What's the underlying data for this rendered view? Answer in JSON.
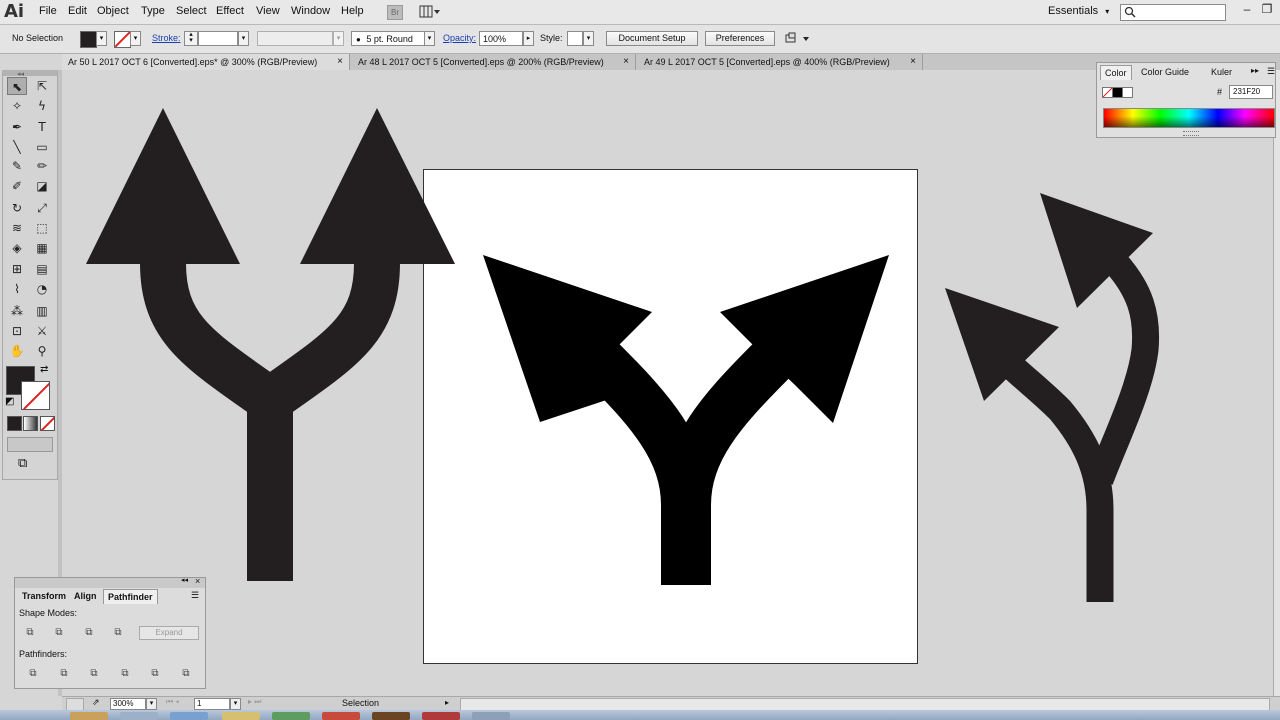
{
  "app": {
    "logo": "Ai"
  },
  "menu": [
    "File",
    "Edit",
    "Object",
    "Type",
    "Select",
    "Effect",
    "View",
    "Window",
    "Help"
  ],
  "bridge_icon": "Br",
  "workspace": {
    "label": "Essentials",
    "arrow": "▾"
  },
  "window_controls": [
    "–",
    "❐"
  ],
  "control_bar": {
    "selection_label": "No Selection",
    "stroke_label": "Stroke:",
    "brush_value": "5 pt. Round",
    "opacity_label": "Opacity:",
    "opacity_value": "100%",
    "style_label": "Style:",
    "document_setup": "Document Setup",
    "preferences": "Preferences"
  },
  "tabs": [
    {
      "label": "Ar 50 L 2017 OCT 6 [Converted].eps* @ 300% (RGB/Preview)",
      "close": "×"
    },
    {
      "label": "Ar 48 L 2017 OCT 5 [Converted].eps @ 200% (RGB/Preview)",
      "close": "×"
    },
    {
      "label": "Ar 49 L 2017 OCT 5 [Converted].eps @ 400% (RGB/Preview)",
      "close": "×"
    }
  ],
  "tools": {
    "selection": "⬉",
    "direct_selection": "⇱",
    "magic_wand": "✧",
    "lasso": "ϟ",
    "pen": "✒",
    "type": "T",
    "line": "╲",
    "rectangle": "▭",
    "paintbrush": "✎",
    "pencil": "✏",
    "blob_brush": "✐",
    "eraser": "◪",
    "rotate": "↻",
    "scale": "⤢",
    "warp": "≋",
    "free_transform": "⬚",
    "shape_builder": "◈",
    "perspective": "▦",
    "mesh": "⊞",
    "gradient": "▤",
    "eyedropper": "⌇",
    "blend": "◔",
    "symbol_sprayer": "⁂",
    "graph": "▥",
    "artboard": "⊡",
    "slice": "⚔",
    "hand": "✋",
    "zoom": "⚲",
    "swap": "⇄",
    "default_colors": "◩",
    "screen_mode": "⧉"
  },
  "color_panel": {
    "tabs": [
      "Color",
      "Color Guide",
      "Kuler"
    ],
    "hex_symbol": "#",
    "hex_value": "231F20",
    "fill_color": "#231f20"
  },
  "pathfinder_panel": {
    "tabs": [
      "Transform",
      "Align",
      "Pathfinder"
    ],
    "shape_modes_label": "Shape Modes:",
    "expand_label": "Expand",
    "pathfinders_label": "Pathfinders:",
    "shape_mode_icons": [
      "⧉",
      "⧉",
      "⧉",
      "⧉"
    ],
    "pathfinder_icons": [
      "⧉",
      "⧉",
      "⧉",
      "⧉",
      "⧉",
      "⧉"
    ]
  },
  "status_bar": {
    "zoom": "300%",
    "page": "1",
    "tool": "Selection"
  }
}
